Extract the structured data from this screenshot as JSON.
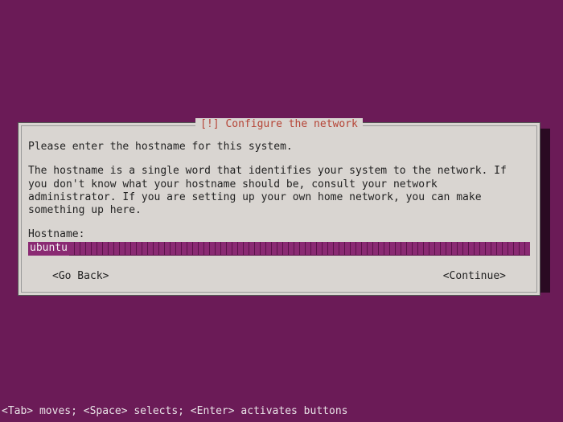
{
  "dialog": {
    "title": "[!] Configure the network",
    "intro": "Please enter the hostname for this system.",
    "description": "The hostname is a single word that identifies your system to the network. If you don't know what your hostname should be, consult your network administrator. If you are setting up your own home network, you can make something up here.",
    "hostname_label": "Hostname:",
    "hostname_value": "ubuntu",
    "go_back": "<Go Back>",
    "continue": "<Continue>"
  },
  "footer": {
    "hint": "<Tab> moves; <Space> selects; <Enter> activates buttons"
  }
}
